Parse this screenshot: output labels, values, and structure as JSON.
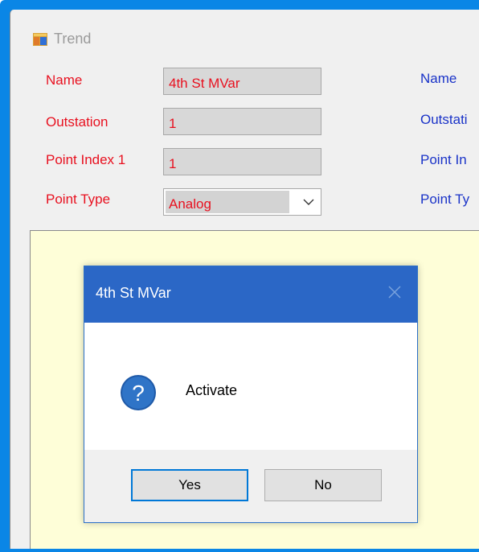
{
  "window": {
    "title": "Trend",
    "icon": "app-window-icon"
  },
  "form": {
    "left_labels": [
      "Name",
      "Outstation",
      "Point Index 1",
      "Point Type"
    ],
    "right_labels": [
      "Name",
      "Outstati",
      "Point In",
      "Point Ty"
    ],
    "name_value": "4th St MVar",
    "outstation_value": "1",
    "point_index_value": "1",
    "point_type_value": "Analog"
  },
  "dialog": {
    "title": "4th St MVar",
    "message": "Activate",
    "icon": "question-icon",
    "yes_label": "Yes",
    "no_label": "No"
  },
  "colors": {
    "frame_border": "#0a86e6",
    "label_red": "#e8101f",
    "label_blue": "#1a33c8",
    "canvas_bg": "#fefed8",
    "dialog_title_bg": "#2b67c6",
    "default_button_border": "#0078d7"
  }
}
